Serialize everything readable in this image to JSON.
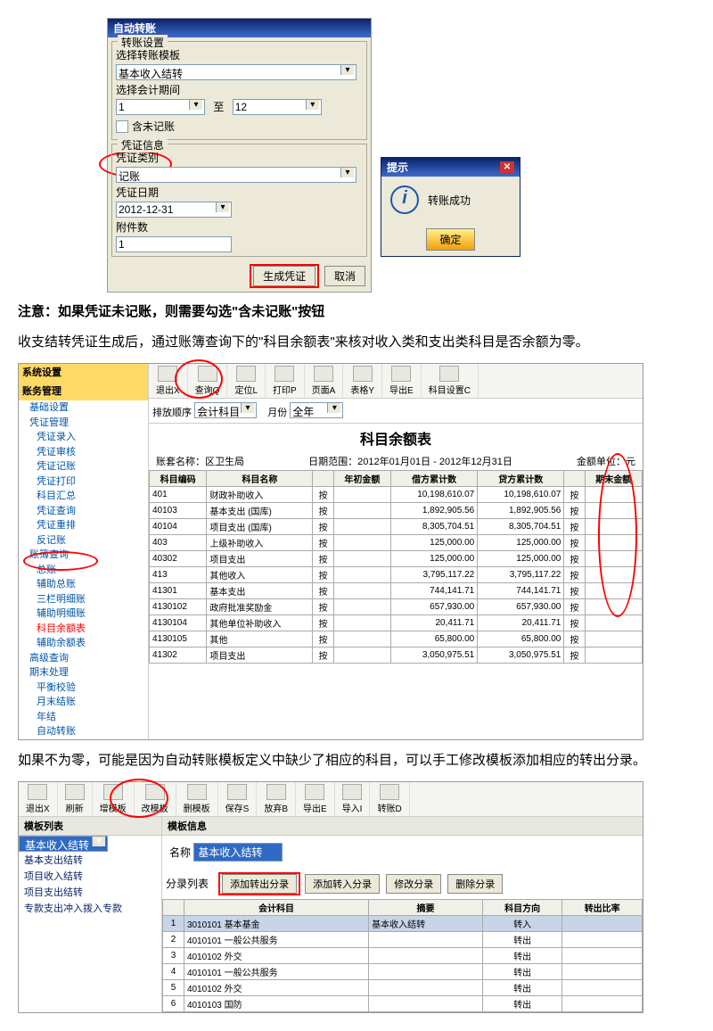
{
  "dlg1": {
    "title": "自动转账",
    "grp1": "转账设置",
    "lbl1": "选择转账模板",
    "tmpl": "基本收入结转",
    "lbl2": "选择会计期间",
    "p1": "1",
    "to": "至",
    "p2": "12",
    "chk": "含未记账",
    "grp2": "凭证信息",
    "lbl3": "凭证类别",
    "type": "记账",
    "lbl4": "凭证日期",
    "date": "2012-12-31",
    "lbl5": "附件数",
    "att": "1",
    "gen": "生成凭证",
    "cancel": "取消"
  },
  "prompt": {
    "title": "提示",
    "msg": "转账成功",
    "ok": "确定"
  },
  "note": "注意：如果凭证未记账，则需要勾选\"含未记账\"按钮",
  "para1": "收支结转凭证生成后，通过账簿查询下的\"科目余额表\"来核对收入类和支出类科目是否余额为零。",
  "tree": {
    "h1": "系统设置",
    "h2": "账务管理",
    "n1": "基础设置",
    "n2": "凭证管理",
    "i21": "凭证录入",
    "i22": "凭证审核",
    "i23": "凭证记账",
    "i24": "凭证打印",
    "i25": "科目汇总",
    "i26": "凭证查询",
    "i27": "凭证重排",
    "i28": "反记账",
    "n3": "账簿查询",
    "i31": "总账",
    "i32": "辅助总账",
    "i33": "三栏明细账",
    "i34": "辅助明细账",
    "i35": "科目余额表",
    "i36": "辅助余额表",
    "n4": "高级查询",
    "n5": "期末处理",
    "i51": "平衡校验",
    "i52": "月末结账",
    "i53": "年结",
    "i54": "自动转账"
  },
  "tb": {
    "b1": "退出X",
    "b2": "查询Q",
    "b3": "定位L",
    "b4": "打印P",
    "b5": "页面A",
    "b6": "表格Y",
    "b7": "导出E",
    "b8": "科目设置C"
  },
  "filter": {
    "l1": "排放顺序",
    "v1": "会计科目",
    "l2": "月份",
    "v2": "全年"
  },
  "rep": {
    "title": "科目余额表",
    "org": "账套名称：区卫生局",
    "date": "日期范围：2012年01月01日 - 2012年12月31日",
    "unit": "金额单位：元",
    "h1": "科目编码",
    "h2": "科目名称",
    "h3": "年初金额",
    "h4": "借方累计数",
    "h5": "贷方累计数",
    "h6": "期末金额"
  },
  "rows": [
    {
      "c": "401",
      "n": "财政补助收入",
      "d": "10,198,610.07",
      "e": "10,198,610.07"
    },
    {
      "c": "40103",
      "n": "基本支出 (国库)",
      "d": "1,892,905.56",
      "e": "1,892,905.56"
    },
    {
      "c": "40104",
      "n": "项目支出 (国库)",
      "d": "8,305,704.51",
      "e": "8,305,704.51"
    },
    {
      "c": "403",
      "n": "上级补助收入",
      "d": "125,000.00",
      "e": "125,000.00"
    },
    {
      "c": "40302",
      "n": "项目支出",
      "d": "125,000.00",
      "e": "125,000.00"
    },
    {
      "c": "413",
      "n": "其他收入",
      "d": "3,795,117.22",
      "e": "3,795,117.22"
    },
    {
      "c": "41301",
      "n": "基本支出",
      "d": "744,141.71",
      "e": "744,141.71"
    },
    {
      "c": "4130102",
      "n": "政府批准奖励金",
      "d": "657,930.00",
      "e": "657,930.00"
    },
    {
      "c": "4130104",
      "n": "其他单位补助收入",
      "d": "20,411.71",
      "e": "20,411.71"
    },
    {
      "c": "4130105",
      "n": "其他",
      "d": "65,800.00",
      "e": "65,800.00"
    },
    {
      "c": "41302",
      "n": "项目支出",
      "d": "3,050,975.51",
      "e": "3,050,975.51"
    }
  ],
  "para2": "如果不为零，可能是因为自动转账模板定义中缺少了相应的科目，可以手工修改模板添加相应的转出分录。",
  "tb2": {
    "b1": "退出X",
    "b2": "刷新",
    "b3": "增模板",
    "b4": "改模板",
    "b5": "删模板",
    "b6": "保存S",
    "b7": "放弃B",
    "b8": "导出E",
    "b9": "导入I",
    "b10": "转账D"
  },
  "tmpl": {
    "h1": "模板列表",
    "h2": "模板信息",
    "li1": "基本收入结转",
    "li2": "基本支出结转",
    "li3": "项目收入结转",
    "li4": "项目支出结转",
    "li5": "专款支出冲入拨入专款",
    "name_l": "名称",
    "name_v": "基本收入结转",
    "sec": "分录列表",
    "t1": "添加转出分录",
    "t2": "添加转入分录",
    "t3": "修改分录",
    "t4": "删除分录",
    "gh1": "会计科目",
    "gh2": "摘要",
    "gh3": "科目方向",
    "gh4": "转出比率"
  },
  "grows": [
    {
      "i": "1",
      "a": "3010101 基本基金",
      "b": "基本收入结转",
      "c": "转入"
    },
    {
      "i": "2",
      "a": "4010101 一般公共服务",
      "b": "",
      "c": "转出"
    },
    {
      "i": "3",
      "a": "4010102 外交",
      "b": "",
      "c": "转出"
    },
    {
      "i": "4",
      "a": "4010101 一般公共服务",
      "b": "",
      "c": "转出"
    },
    {
      "i": "5",
      "a": "4010102 外交",
      "b": "",
      "c": "转出"
    },
    {
      "i": "6",
      "a": "4010103 国防",
      "b": "",
      "c": "转出"
    }
  ]
}
